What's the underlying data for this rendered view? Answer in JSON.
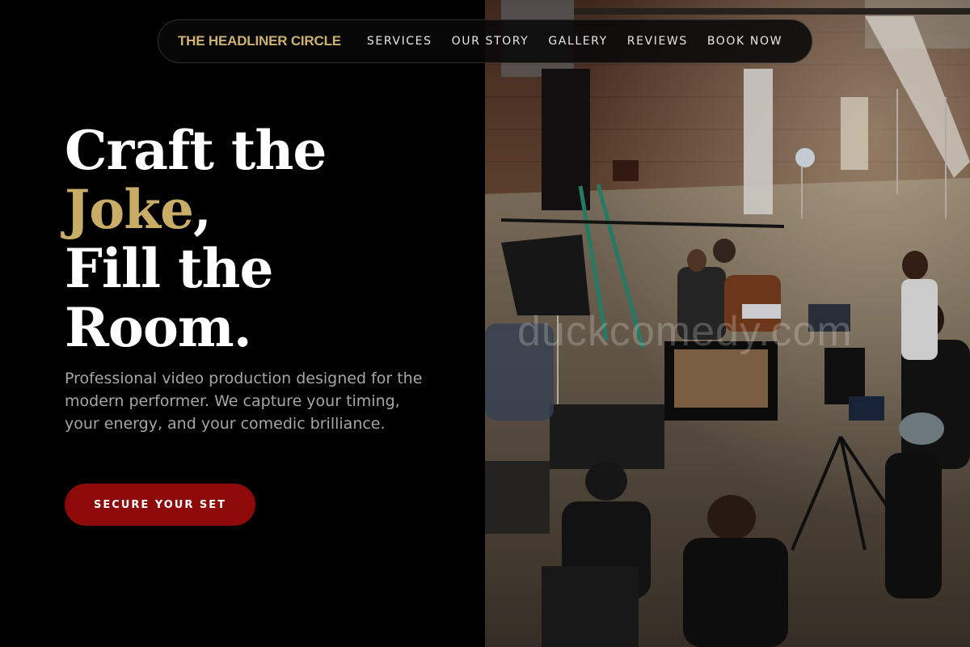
{
  "nav": {
    "brand": "THE HEADLINER CIRCLE",
    "links": [
      "SERVICES",
      "OUR STORY",
      "GALLERY",
      "REVIEWS",
      "BOOK NOW"
    ]
  },
  "hero": {
    "line1": "Craft the",
    "accent_word": "Joke",
    "accent_suffix": ",",
    "line3": "Fill the",
    "line4": "Room.",
    "subtitle": "Professional video production designed for the modern performer. We capture your timing, your energy, and your comedic brilliance.",
    "cta_label": "SECURE YOUR SET"
  },
  "watermark": "duckcomedy.com",
  "colors": {
    "background": "#000000",
    "accent_gold": "#c9ad66",
    "brand_gold": "#cdb170",
    "cta_red": "#8e0a0a",
    "subtitle_gray": "#a6a6a6"
  }
}
